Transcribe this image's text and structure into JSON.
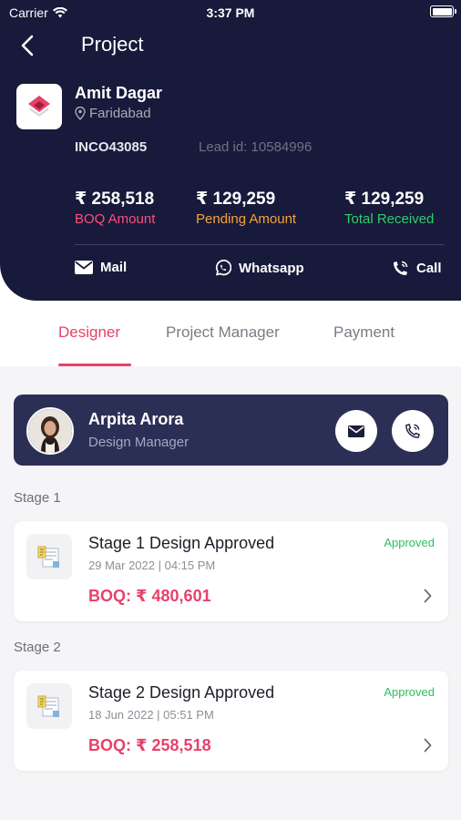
{
  "status_bar": {
    "carrier": "Carrier",
    "time": "3:37 PM"
  },
  "header": {
    "title": "Project",
    "client_name": "Amit Dagar",
    "location": "Faridabad",
    "project_code": "INCO43085",
    "lead_id": "Lead id: 10584996",
    "amounts": {
      "boq": {
        "value": "₹ 258,518",
        "label": "BOQ Amount"
      },
      "pending": {
        "value": "₹ 129,259",
        "label": "Pending Amount"
      },
      "received": {
        "value": "₹ 129,259",
        "label": "Total Received"
      }
    },
    "contacts": {
      "mail": "Mail",
      "whatsapp": "Whatsapp",
      "call": "Call"
    }
  },
  "tabs": [
    "Designer",
    "Project Manager",
    "Payment"
  ],
  "manager": {
    "name": "Arpita Arora",
    "role": "Design Manager"
  },
  "stages": [
    {
      "group": "Stage 1",
      "title": "Stage 1 Design Approved",
      "date": "29 Mar 2022 | 04:15 PM",
      "boq": "BOQ: ₹ 480,601",
      "status": "Approved"
    },
    {
      "group": "Stage 2",
      "title": "Stage 2 Design Approved",
      "date": "18 Jun 2022 | 05:51 PM",
      "boq": "BOQ: ₹ 258,518",
      "status": "Approved"
    }
  ],
  "colors": {
    "header_bg": "#171a3a",
    "accent": "#e8416a",
    "pending": "#f7a33a",
    "received": "#2ecf6b",
    "card_dark": "#2c2f55"
  }
}
